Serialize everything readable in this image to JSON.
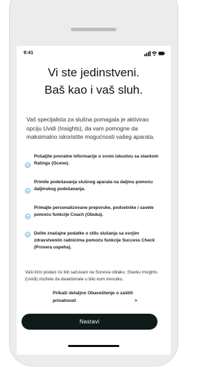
{
  "status_bar": {
    "time": "9:41"
  },
  "title": {
    "line1": "Vi ste jedinstveni.",
    "line2": "Baš kao i vaš sluh."
  },
  "intro": "Vaš specijalista za slušna pomagala je aktivirao opciju Uvidi (Insights), da vam pomogne da maksimalno iskoristite mogućnosti vašeg aparata.",
  "features": [
    {
      "text": "Pošaljite povratne informacije o svom iskustvu sa stavkom Ratings (Ocene)."
    },
    {
      "text": "Primite podešavanja slušnog aparata na daljinu pomoću daljinskog podešavanja."
    },
    {
      "text": "Primajte personalizovane preporuke, podsetnike i savete pomoću funkcije Coach (Obuka)."
    },
    {
      "text": "Delite značajne podatke o stilu slušanja sa svojim zdravstvenim radnicima pomoću funkcije Success Check (Provera uspeha)."
    }
  ],
  "privacy_text": "Vaši lični podaci će biti sačuvani na Sonova oblaku. Stavku Insights (Uvidi) možete da deaktivirate u bilo kom trenutku.",
  "privacy_link": {
    "line1": "Prikaži detaljno Obaveštenje o zaštiti",
    "line2": "privatnosti",
    "chevron": ">"
  },
  "cta_label": "Nastavi",
  "colors": {
    "accent": "#2a9fd8",
    "button": "#0f1a1a",
    "frame": "#ececec"
  }
}
